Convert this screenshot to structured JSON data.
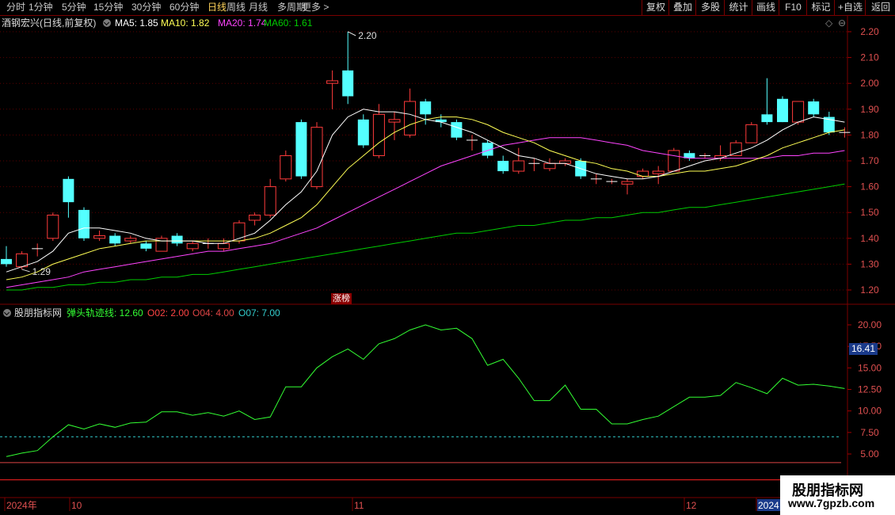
{
  "toolbar": {
    "tabs": [
      "分时",
      "1分钟",
      "5分钟",
      "15分钟",
      "30分钟",
      "60分钟",
      "日线",
      "周线",
      "月线",
      "多周期",
      "更多 >"
    ],
    "active_tab": "日线",
    "right_buttons": [
      "复权",
      "叠加",
      "多股",
      "统计",
      "画线",
      "F10",
      "标记",
      "+自选",
      "返回"
    ]
  },
  "main_panel": {
    "stock_name": "酒钢宏兴(日线,前复权)",
    "ma5_label": "MA5: 1.85",
    "ma10_label": "MA10: 1.82",
    "ma20_label": "MA20: 1.74",
    "ma60_label": "MA60: 1.61",
    "high_annotation": "2.20",
    "low_annotation": "1.29",
    "event_badge": "涨榜",
    "y_ticks": [
      "2.20",
      "2.10",
      "2.00",
      "1.90",
      "1.80",
      "1.70",
      "1.60",
      "1.50",
      "1.40",
      "1.30",
      "1.20"
    ]
  },
  "indicator_panel": {
    "name": "股朋指标网",
    "line_label": "弹头轨迹线: 12.60",
    "o02_label": "O02: 2.00",
    "o04_label": "O04: 4.00",
    "o07_label": "O07: 7.00",
    "current_value": "16.41",
    "y_ticks": [
      "20.00",
      "17.50",
      "15.00",
      "12.50",
      "10.00",
      "7.50",
      "5.00"
    ]
  },
  "date_axis": {
    "labels": [
      "2024年",
      "10",
      "11",
      "12",
      "2024"
    ]
  },
  "watermark": {
    "title": "股朋指标网",
    "url": "www.7gpzb.com"
  },
  "colors": {
    "up": "#ff3b3b",
    "down": "#54ffff",
    "ma5": "#ffffff",
    "ma10": "#ffff55",
    "ma20": "#ff44ff",
    "ma60": "#00cc00",
    "indicator": "#33ff33"
  },
  "chart_data": [
    {
      "type": "candlestick",
      "ylim": [
        1.2,
        2.25
      ],
      "candles": [
        {
          "o": 1.32,
          "c": 1.3,
          "h": 1.37,
          "l": 1.29
        },
        {
          "o": 1.29,
          "c": 1.34,
          "h": 1.35,
          "l": 1.28
        },
        {
          "o": 1.36,
          "c": 1.36,
          "h": 1.38,
          "l": 1.33
        },
        {
          "o": 1.4,
          "c": 1.49,
          "h": 1.5,
          "l": 1.39
        },
        {
          "o": 1.63,
          "c": 1.54,
          "h": 1.64,
          "l": 1.48
        },
        {
          "o": 1.51,
          "c": 1.4,
          "h": 1.52,
          "l": 1.39
        },
        {
          "o": 1.4,
          "c": 1.41,
          "h": 1.43,
          "l": 1.39
        },
        {
          "o": 1.41,
          "c": 1.38,
          "h": 1.42,
          "l": 1.37
        },
        {
          "o": 1.39,
          "c": 1.4,
          "h": 1.41,
          "l": 1.38
        },
        {
          "o": 1.38,
          "c": 1.36,
          "h": 1.39,
          "l": 1.35
        },
        {
          "o": 1.35,
          "c": 1.4,
          "h": 1.41,
          "l": 1.35
        },
        {
          "o": 1.41,
          "c": 1.38,
          "h": 1.42,
          "l": 1.37
        },
        {
          "o": 1.36,
          "c": 1.38,
          "h": 1.39,
          "l": 1.35
        },
        {
          "o": 1.38,
          "c": 1.38,
          "h": 1.4,
          "l": 1.36
        },
        {
          "o": 1.36,
          "c": 1.38,
          "h": 1.4,
          "l": 1.35
        },
        {
          "o": 1.39,
          "c": 1.46,
          "h": 1.47,
          "l": 1.38
        },
        {
          "o": 1.47,
          "c": 1.49,
          "h": 1.5,
          "l": 1.45
        },
        {
          "o": 1.49,
          "c": 1.6,
          "h": 1.63,
          "l": 1.48
        },
        {
          "o": 1.63,
          "c": 1.72,
          "h": 1.74,
          "l": 1.62
        },
        {
          "o": 1.85,
          "c": 1.64,
          "h": 1.86,
          "l": 1.63
        },
        {
          "o": 1.6,
          "c": 1.83,
          "h": 1.85,
          "l": 1.59
        },
        {
          "o": 2.0,
          "c": 2.01,
          "h": 2.05,
          "l": 1.9
        },
        {
          "o": 2.05,
          "c": 1.95,
          "h": 2.2,
          "l": 1.92
        },
        {
          "o": 1.86,
          "c": 1.76,
          "h": 1.88,
          "l": 1.75
        },
        {
          "o": 1.72,
          "c": 1.88,
          "h": 1.92,
          "l": 1.71
        },
        {
          "o": 1.85,
          "c": 1.86,
          "h": 1.89,
          "l": 1.78
        },
        {
          "o": 1.8,
          "c": 1.93,
          "h": 1.98,
          "l": 1.79
        },
        {
          "o": 1.93,
          "c": 1.88,
          "h": 1.94,
          "l": 1.84
        },
        {
          "o": 1.86,
          "c": 1.85,
          "h": 1.88,
          "l": 1.83
        },
        {
          "o": 1.85,
          "c": 1.79,
          "h": 1.86,
          "l": 1.78
        },
        {
          "o": 1.78,
          "c": 1.78,
          "h": 1.8,
          "l": 1.74
        },
        {
          "o": 1.77,
          "c": 1.72,
          "h": 1.78,
          "l": 1.71
        },
        {
          "o": 1.7,
          "c": 1.66,
          "h": 1.72,
          "l": 1.65
        },
        {
          "o": 1.66,
          "c": 1.7,
          "h": 1.75,
          "l": 1.65
        },
        {
          "o": 1.69,
          "c": 1.69,
          "h": 1.71,
          "l": 1.66
        },
        {
          "o": 1.67,
          "c": 1.69,
          "h": 1.71,
          "l": 1.66
        },
        {
          "o": 1.69,
          "c": 1.7,
          "h": 1.71,
          "l": 1.68
        },
        {
          "o": 1.7,
          "c": 1.64,
          "h": 1.71,
          "l": 1.63
        },
        {
          "o": 1.63,
          "c": 1.63,
          "h": 1.65,
          "l": 1.61
        },
        {
          "o": 1.62,
          "c": 1.62,
          "h": 1.63,
          "l": 1.61
        },
        {
          "o": 1.61,
          "c": 1.62,
          "h": 1.63,
          "l": 1.57
        },
        {
          "o": 1.64,
          "c": 1.66,
          "h": 1.67,
          "l": 1.63
        },
        {
          "o": 1.65,
          "c": 1.66,
          "h": 1.68,
          "l": 1.61
        },
        {
          "o": 1.66,
          "c": 1.74,
          "h": 1.75,
          "l": 1.66
        },
        {
          "o": 1.73,
          "c": 1.71,
          "h": 1.74,
          "l": 1.7
        },
        {
          "o": 1.72,
          "c": 1.72,
          "h": 1.73,
          "l": 1.71
        },
        {
          "o": 1.71,
          "c": 1.72,
          "h": 1.76,
          "l": 1.7
        },
        {
          "o": 1.72,
          "c": 1.77,
          "h": 1.78,
          "l": 1.72
        },
        {
          "o": 1.77,
          "c": 1.84,
          "h": 1.85,
          "l": 1.77
        },
        {
          "o": 1.88,
          "c": 1.85,
          "h": 2.02,
          "l": 1.84
        },
        {
          "o": 1.94,
          "c": 1.85,
          "h": 1.95,
          "l": 1.85
        },
        {
          "o": 1.85,
          "c": 1.93,
          "h": 1.93,
          "l": 1.84
        },
        {
          "o": 1.93,
          "c": 1.88,
          "h": 1.94,
          "l": 1.87
        },
        {
          "o": 1.87,
          "c": 1.81,
          "h": 1.89,
          "l": 1.8
        },
        {
          "o": 1.81,
          "c": 1.81,
          "h": 1.83,
          "l": 1.79
        }
      ],
      "ma5": [
        1.27,
        1.29,
        1.31,
        1.35,
        1.42,
        1.44,
        1.44,
        1.43,
        1.42,
        1.4,
        1.39,
        1.39,
        1.39,
        1.38,
        1.38,
        1.4,
        1.42,
        1.47,
        1.53,
        1.58,
        1.66,
        1.8,
        1.87,
        1.9,
        1.89,
        1.89,
        1.88,
        1.86,
        1.85,
        1.83,
        1.81,
        1.78,
        1.75,
        1.72,
        1.71,
        1.69,
        1.69,
        1.67,
        1.65,
        1.64,
        1.63,
        1.63,
        1.64,
        1.66,
        1.68,
        1.7,
        1.71,
        1.73,
        1.75,
        1.78,
        1.82,
        1.85,
        1.87,
        1.86,
        1.85
      ],
      "ma10": [
        1.24,
        1.25,
        1.27,
        1.3,
        1.32,
        1.34,
        1.36,
        1.37,
        1.38,
        1.39,
        1.39,
        1.39,
        1.39,
        1.39,
        1.39,
        1.39,
        1.4,
        1.42,
        1.45,
        1.48,
        1.53,
        1.6,
        1.67,
        1.72,
        1.77,
        1.81,
        1.84,
        1.86,
        1.87,
        1.87,
        1.86,
        1.84,
        1.81,
        1.79,
        1.77,
        1.74,
        1.72,
        1.7,
        1.69,
        1.67,
        1.66,
        1.64,
        1.64,
        1.65,
        1.66,
        1.66,
        1.67,
        1.68,
        1.7,
        1.72,
        1.75,
        1.77,
        1.79,
        1.81,
        1.82
      ],
      "ma20": [
        1.21,
        1.22,
        1.23,
        1.24,
        1.25,
        1.27,
        1.28,
        1.29,
        1.3,
        1.31,
        1.32,
        1.33,
        1.34,
        1.35,
        1.35,
        1.36,
        1.37,
        1.38,
        1.4,
        1.42,
        1.44,
        1.47,
        1.5,
        1.53,
        1.56,
        1.59,
        1.62,
        1.65,
        1.68,
        1.7,
        1.72,
        1.74,
        1.76,
        1.77,
        1.78,
        1.79,
        1.79,
        1.79,
        1.78,
        1.77,
        1.76,
        1.74,
        1.73,
        1.72,
        1.71,
        1.71,
        1.71,
        1.71,
        1.71,
        1.71,
        1.72,
        1.72,
        1.73,
        1.73,
        1.74
      ],
      "ma60": [
        1.2,
        1.2,
        1.21,
        1.21,
        1.22,
        1.22,
        1.23,
        1.23,
        1.24,
        1.24,
        1.25,
        1.25,
        1.26,
        1.26,
        1.27,
        1.28,
        1.29,
        1.3,
        1.31,
        1.32,
        1.33,
        1.34,
        1.35,
        1.36,
        1.37,
        1.38,
        1.39,
        1.4,
        1.41,
        1.42,
        1.42,
        1.43,
        1.44,
        1.45,
        1.45,
        1.46,
        1.47,
        1.47,
        1.48,
        1.48,
        1.49,
        1.5,
        1.5,
        1.51,
        1.52,
        1.52,
        1.53,
        1.54,
        1.55,
        1.56,
        1.57,
        1.58,
        1.59,
        1.6,
        1.61
      ]
    },
    {
      "type": "line",
      "name": "弹头轨迹线",
      "ylim": [
        3.0,
        21.5
      ],
      "values": [
        4.7,
        5.1,
        5.4,
        7.0,
        8.4,
        7.9,
        8.5,
        8.1,
        8.6,
        8.7,
        9.9,
        9.9,
        9.5,
        9.8,
        9.4,
        10.0,
        9.0,
        9.3,
        12.8,
        12.8,
        15.0,
        16.3,
        17.2,
        16.0,
        17.8,
        18.4,
        19.4,
        20.0,
        19.4,
        19.6,
        18.4,
        15.3,
        16.0,
        13.8,
        11.2,
        11.2,
        13.0,
        10.2,
        10.2,
        8.5,
        8.5,
        9.0,
        9.4,
        10.5,
        11.6,
        11.6,
        11.8,
        13.3,
        12.7,
        12.0,
        13.8,
        13.0,
        13.1,
        12.9,
        12.6
      ],
      "o02": 2.0,
      "o04": 4.0,
      "o07": 7.0
    }
  ]
}
